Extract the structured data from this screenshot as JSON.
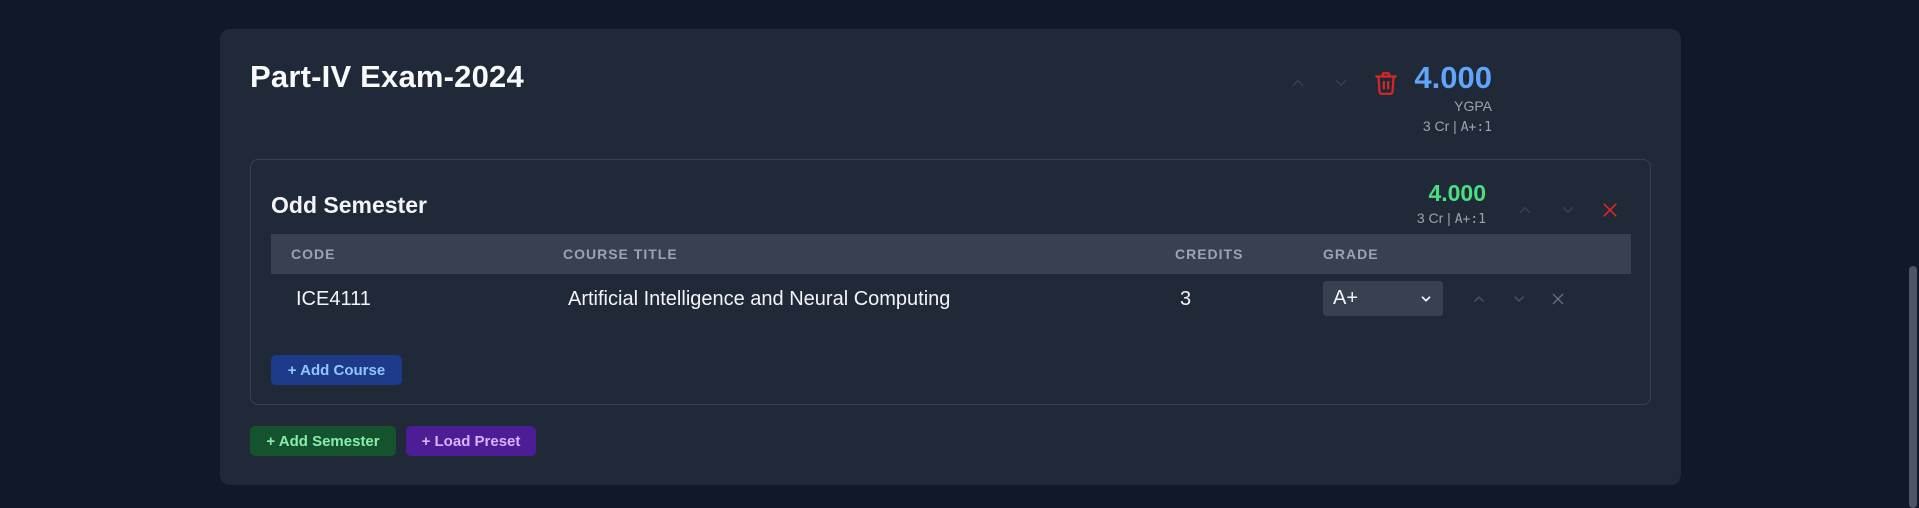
{
  "year": {
    "title": "Part-IV Exam-2024",
    "gpa": "4.000",
    "gpa_label": "YGPA",
    "credits_text": "3 Cr",
    "separator": "|",
    "grade_summary": "A+:1"
  },
  "semester": {
    "title": "Odd Semester",
    "gpa": "4.000",
    "credits_text": "3 Cr",
    "separator": "|",
    "grade_summary": "A+:1",
    "table": {
      "headers": [
        "CODE",
        "COURSE TITLE",
        "CREDITS",
        "GRADE"
      ],
      "rows": [
        {
          "code": "ICE4111",
          "title": "Artificial Intelligence and Neural Computing",
          "credits": "3",
          "grade": "A+"
        }
      ]
    },
    "add_course_label": "+ Add Course"
  },
  "actions": {
    "add_semester_label": "+ Add Semester",
    "load_preset_label": "+ Load Preset"
  },
  "icons": {
    "move_up": "chevron-up-icon",
    "move_down": "chevron-down-icon",
    "delete_year": "trash-icon",
    "remove": "close-icon"
  },
  "colors": {
    "background": "#111827",
    "card": "#1f2937",
    "year_gpa": "#60a5fa",
    "semester_gpa": "#4ade80",
    "danger": "#dc2626",
    "add_course_bg": "#1e3a8a",
    "add_semester_bg": "#14532d",
    "load_preset_bg": "#4c1d95"
  }
}
